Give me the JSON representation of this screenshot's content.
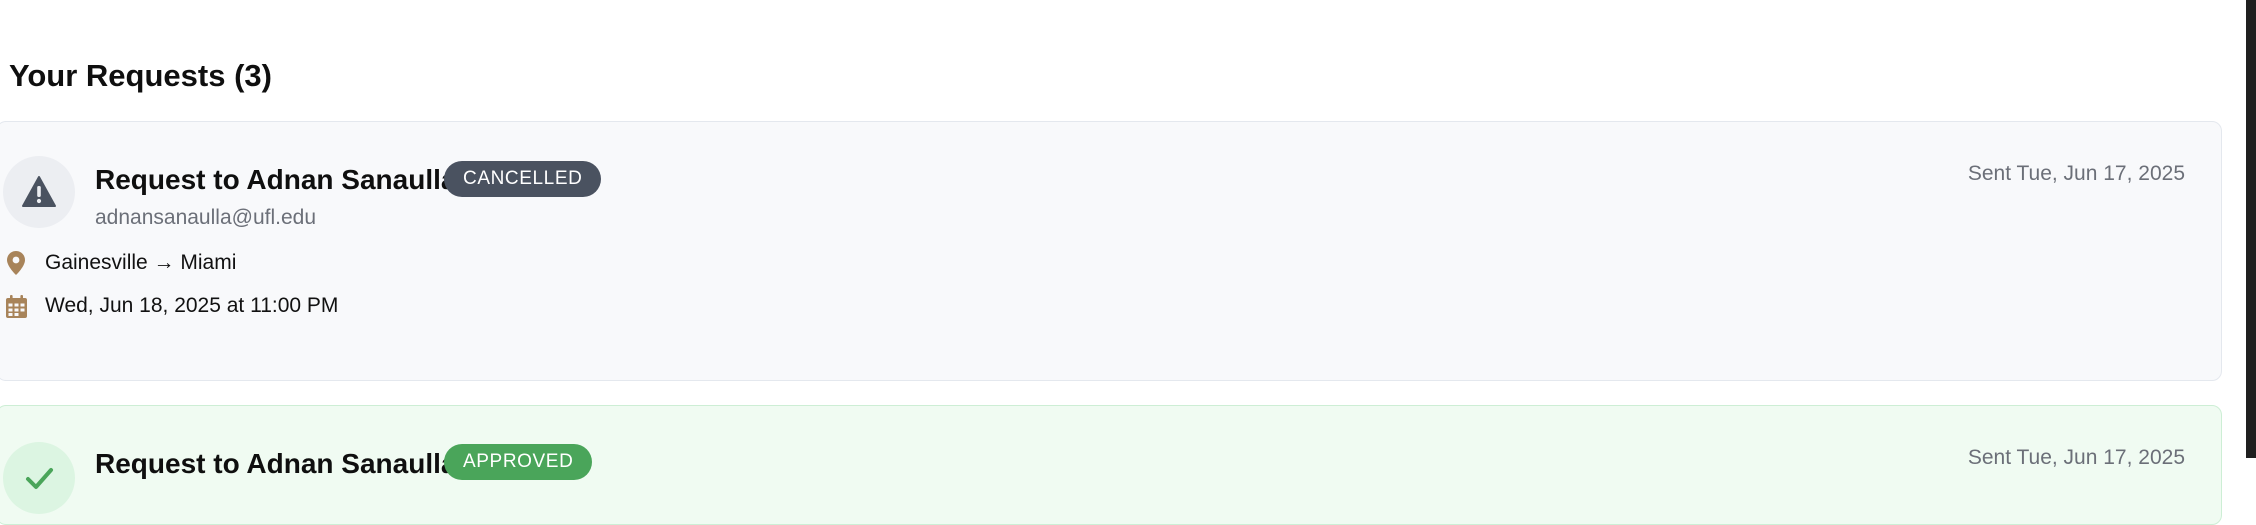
{
  "section": {
    "title": "Your Requests (3)"
  },
  "colors": {
    "cancelled_badge": "#4a5260",
    "approved_badge": "#4aa55a",
    "info_icon": "#a8845a"
  },
  "requests": [
    {
      "title": "Request to Adnan Sanaulla",
      "status": "CANCELLED",
      "email": "adnansanaulla@ufl.edu",
      "sent": "Sent Tue, Jun 17, 2025",
      "route": "Gainesville → Miami",
      "datetime": "Wed, Jun 18, 2025 at 11:00 PM",
      "status_icon": "warning-icon"
    },
    {
      "title": "Request to Adnan Sanaulla",
      "status": "APPROVED",
      "sent": "Sent Tue, Jun 17, 2025",
      "status_icon": "check-icon"
    }
  ]
}
